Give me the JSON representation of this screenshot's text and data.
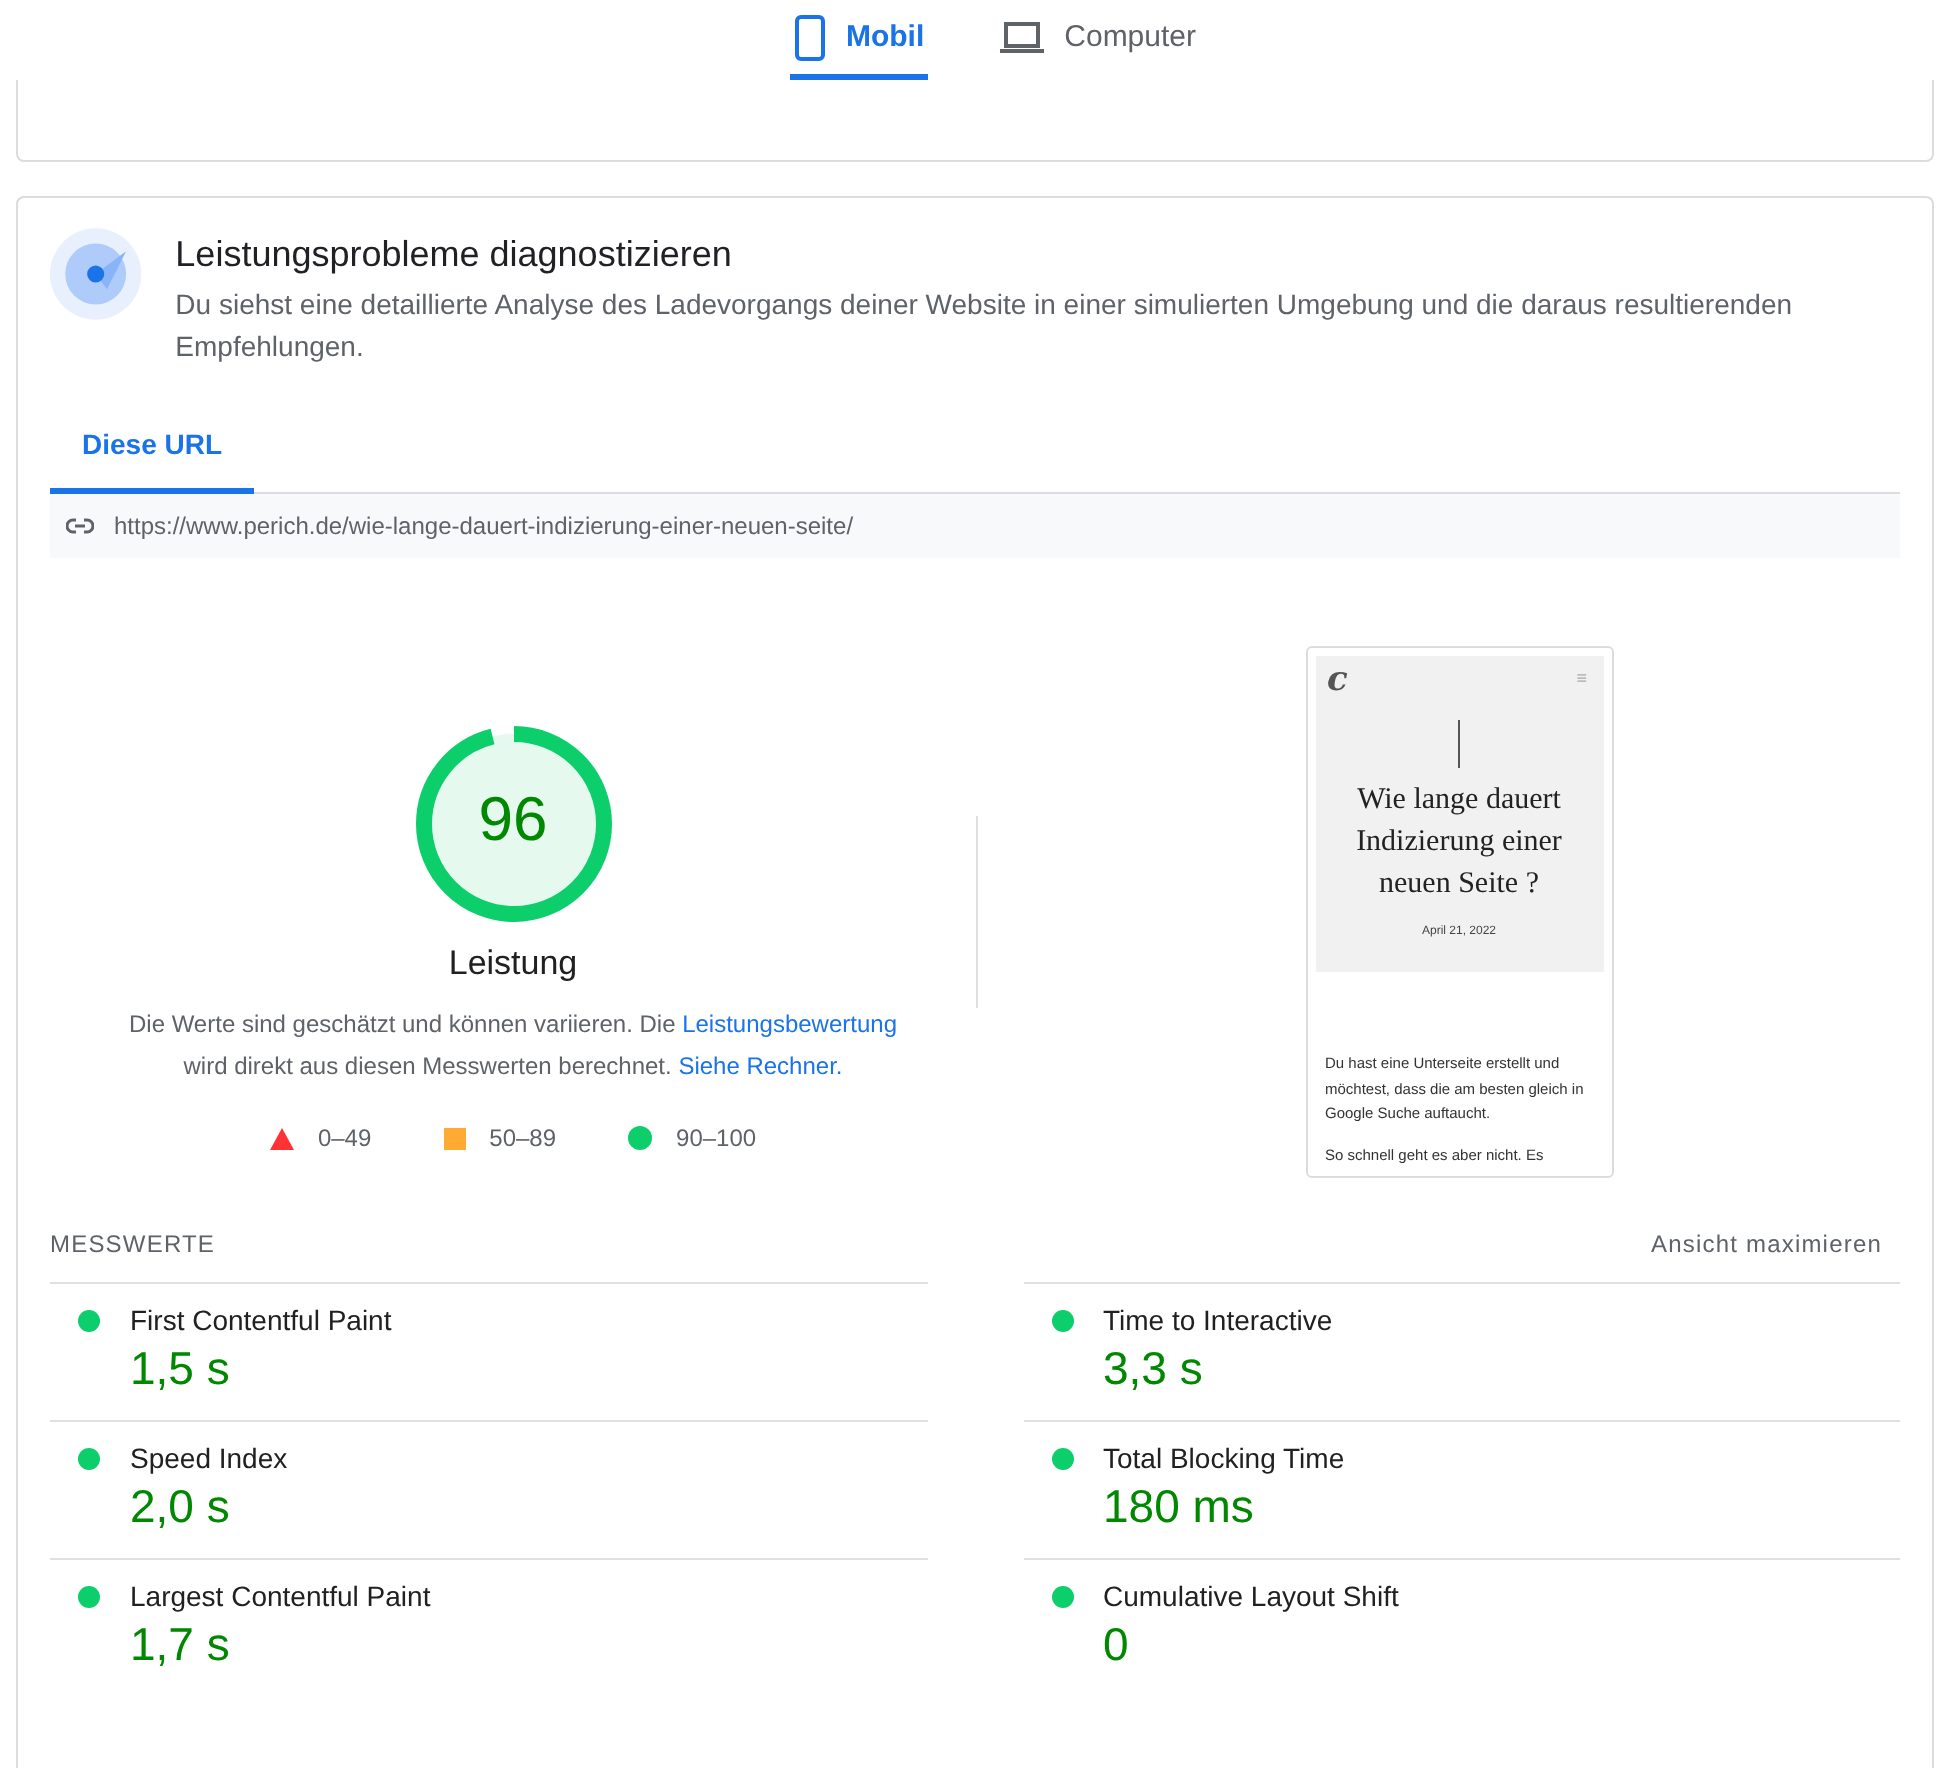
{
  "device_tabs": [
    {
      "label": "Mobil",
      "kind": "phone",
      "selected": true
    },
    {
      "label": "Computer",
      "kind": "laptop",
      "selected": false
    }
  ],
  "diagnose": {
    "title": "Leistungsprobleme diagnostizieren",
    "description": "Du siehst eine detaillierte Analyse des Ladevorgangs deiner Website in einer simulierten Umgebung und die daraus resultierenden Empfehlungen.",
    "tabs": [
      {
        "label": "Diese URL",
        "selected": true
      }
    ],
    "url": "https://www.perich.de/wie-lange-dauert-indizierung-einer-neuen-seite/"
  },
  "score": {
    "value": "96",
    "level": 0.96,
    "label": "Leistung",
    "note_before": "Die Werte sind geschätzt und können variieren. Die ",
    "note_link": "Leistungsbewertung",
    "note_middle": " wird direkt aus diesen Messwerten berechnet. ",
    "note_link_2": "Siehe Rechner.",
    "legend": [
      {
        "kind": "triangle",
        "color": "#ff3333",
        "label": "0–49"
      },
      {
        "kind": "square",
        "color": "#ffaa33",
        "label": "50–89"
      },
      {
        "kind": "circle",
        "color": "#0cce6b",
        "label": "90–100"
      }
    ]
  },
  "preview": {
    "logo": "c",
    "menu": "≡",
    "title": "Wie lange dauert Indizierung einer neuen Seite ?",
    "date": "April 21, 2022",
    "paragraphs": [
      "Du hast eine Unterseite erstellt und möchtest, dass die am besten gleich in Google Suche auftaucht.",
      "So schnell geht es aber nicht. Es"
    ]
  },
  "metrics": {
    "heading": "MESSWERTE",
    "expand": "Ansicht maximieren",
    "items": [
      {
        "name": "First Contentful Paint",
        "value": "1,5 s",
        "color": "#0cce6b"
      },
      {
        "name": "Time to Interactive",
        "value": "3,3 s",
        "color": "#0cce6b"
      },
      {
        "name": "Speed Index",
        "value": "2,0 s",
        "color": "#0cce6b"
      },
      {
        "name": "Total Blocking Time",
        "value": "180 ms",
        "color": "#0cce6b"
      },
      {
        "name": "Largest Contentful Paint",
        "value": "1,7 s",
        "color": "#0cce6b"
      },
      {
        "name": "Cumulative Layout Shift",
        "value": "0",
        "color": "#0cce6b"
      }
    ]
  }
}
